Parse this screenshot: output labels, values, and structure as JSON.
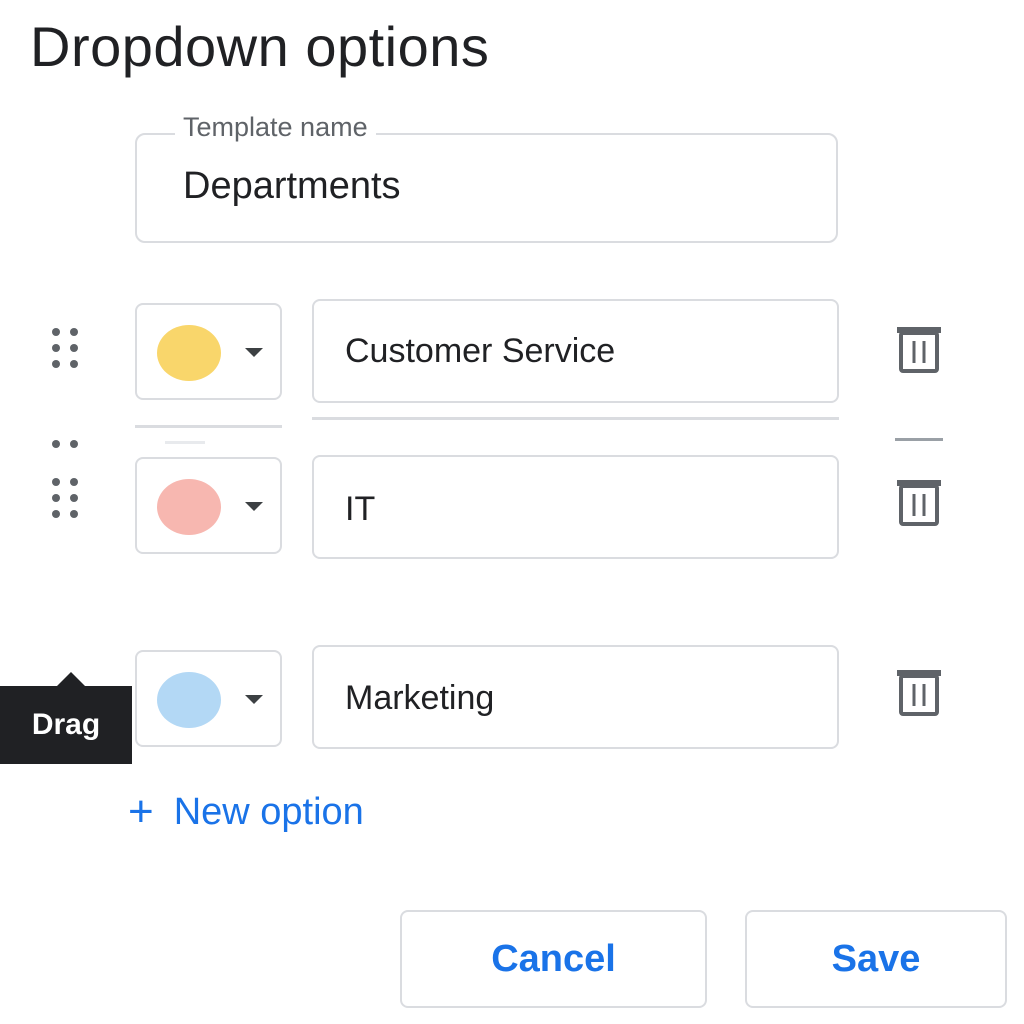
{
  "dialog": {
    "title": "Dropdown options",
    "template_name_label": "Template name",
    "template_name_value": "Departments"
  },
  "options": [
    {
      "label": "Customer Service",
      "color": "#f9d66b",
      "color_name": "yellow"
    },
    {
      "label": "",
      "color": "#e8eaed",
      "color_name": "grey",
      "state": "drop-placeholder"
    },
    {
      "label": "IT",
      "color": "#f7b7b0",
      "color_name": "pink"
    },
    {
      "label": "Marketing",
      "color": "#b3d8f5",
      "color_name": "light-blue"
    }
  ],
  "icons": {
    "drag": "drag-handle-icon",
    "caret": "chevron-down-icon",
    "delete": "trash-icon",
    "add": "plus-icon"
  },
  "tooltip": {
    "text": "Drag"
  },
  "actions": {
    "new_option": "New option",
    "cancel": "Cancel",
    "save": "Save"
  },
  "colors": {
    "accent": "#1a73e8",
    "border": "#dadce0",
    "tooltip_bg": "#202124"
  }
}
